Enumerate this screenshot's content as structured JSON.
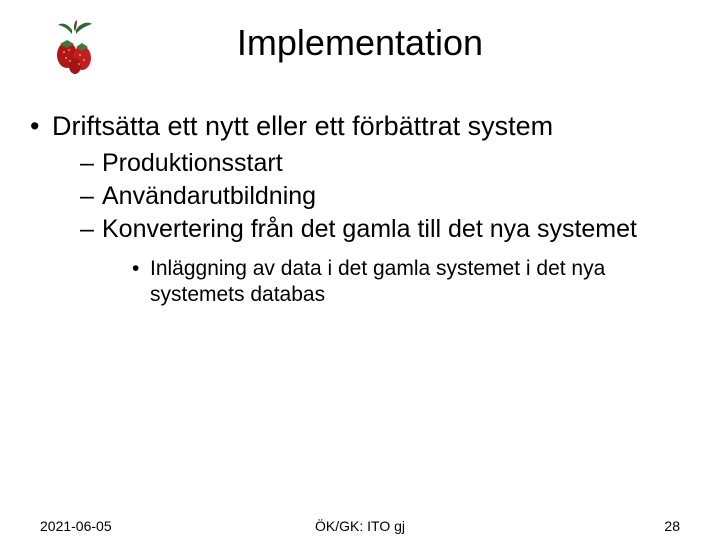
{
  "title": "Implementation",
  "bullets": {
    "l1": "Driftsätta ett nytt eller ett förbättrat system",
    "l2a": "Produktionsstart",
    "l2b": "Användarutbildning",
    "l2c": "Konvertering från det gamla till det nya systemet",
    "l3a": "Inläggning av data  i det gamla systemet i det nya systemets databas"
  },
  "footer": {
    "date": "2021-06-05",
    "center": "ÖK/GK: ITO gj",
    "page": "28"
  }
}
